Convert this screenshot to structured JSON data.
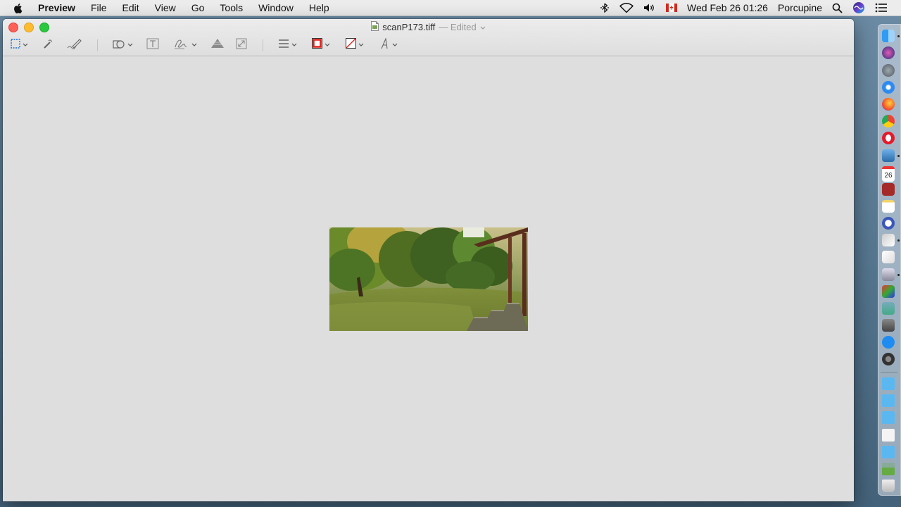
{
  "menubar": {
    "app_name": "Preview",
    "menus": [
      "File",
      "Edit",
      "View",
      "Go",
      "Tools",
      "Window",
      "Help"
    ],
    "status": {
      "datetime": "Wed Feb 26  01:26",
      "user": "Porcupine"
    }
  },
  "window": {
    "filename": "scanP173.tiff",
    "edited_label": "— Edited"
  },
  "toolbar": {
    "tools": [
      "rectangular-selection",
      "instant-alpha",
      "sketch",
      "shapes",
      "text",
      "sign",
      "adjust-color",
      "adjust-size",
      "shape-style",
      "border-color",
      "fill-color",
      "text-style"
    ],
    "border_color": "#e0201a",
    "fill_color": "none"
  },
  "document": {
    "image": "garden scene with lawn, trees and wooden porch"
  },
  "dock": {
    "apps": [
      "finder-icon",
      "siri-icon",
      "launchpad-icon",
      "safari-icon",
      "firefox-icon",
      "chrome-icon",
      "opera-icon",
      "preview-icon",
      "calendar-icon",
      "dictionary-icon",
      "notes-icon",
      "pages-icon",
      "textedit-icon",
      "script-editor-icon",
      "scanner-icon",
      "photo-booth-icon",
      "preview-image-icon",
      "image-capture-icon",
      "app-store-icon",
      "system-preferences-icon",
      "folder-icon",
      "folder-icon",
      "folder-icon",
      "documents-icon",
      "downloads-icon",
      "image-thumb-icon",
      "trash-icon"
    ],
    "calendar_day": "26"
  },
  "colors": {
    "close": "#fe5f57",
    "minimize": "#febc2e",
    "maximize": "#28c840",
    "toolbar_accent": "#1a6fe0"
  }
}
